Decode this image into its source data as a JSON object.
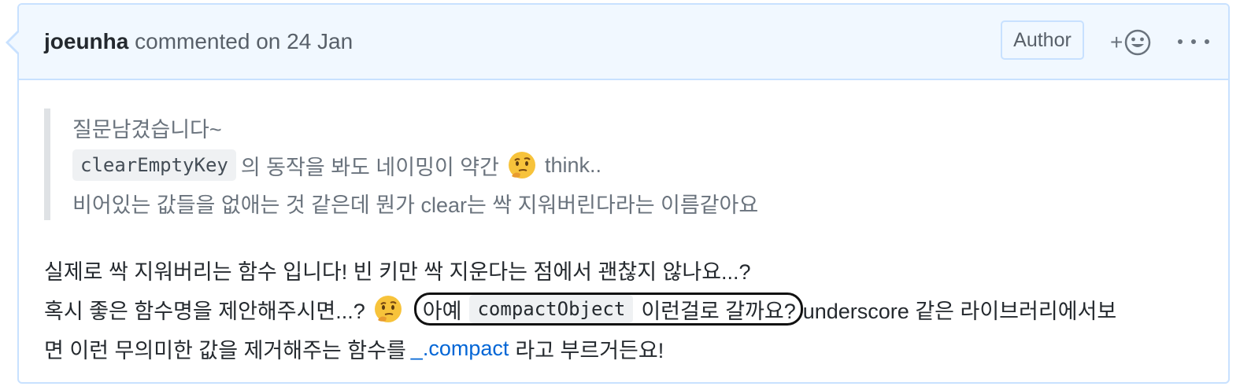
{
  "header": {
    "author": "joeunha",
    "action": "commented on 24 Jan",
    "badge": "Author",
    "reaction_plus": "+",
    "reaction_icon": "smiley-icon",
    "more_icon": "kebab-horizontal-icon"
  },
  "quote": {
    "line1": "질문남겼습니다~",
    "line2_code": "clearEmptyKey",
    "line2_text": "의 동작을 봐도 네이밍이 약간",
    "line2_emoji": "thinking-face",
    "line2_tail": "think..",
    "line3": "비어있는 값들을 없애는 것 같은데 뭔가 clear는 싹 지워버린다라는 이름같아요"
  },
  "body": {
    "line1": "실제로 싹 지워버리는 함수 입니다! 빈 키만 싹 지운다는 점에서 괜찮지 않나요...?",
    "line2_pre": "혹시 좋은 함수명을 제안해주시면...?",
    "line2_emoji": "thinking-face",
    "line2_highlight_pre": "아예",
    "line2_highlight_code": "compactObject",
    "line2_highlight_post": "이런걸로 갈까요?",
    "line2_post": "underscore 같은 라이브러리에서보",
    "line3_pre": "면 이런 무의미한 값을 제거해주는 함수를",
    "line3_link": "_.compact",
    "line3_post": "라고 부르거든요!"
  },
  "colors": {
    "border": "#c8e1ff",
    "header_bg": "#f1f8ff",
    "link": "#0366d6",
    "quote_text": "#6a737d"
  }
}
